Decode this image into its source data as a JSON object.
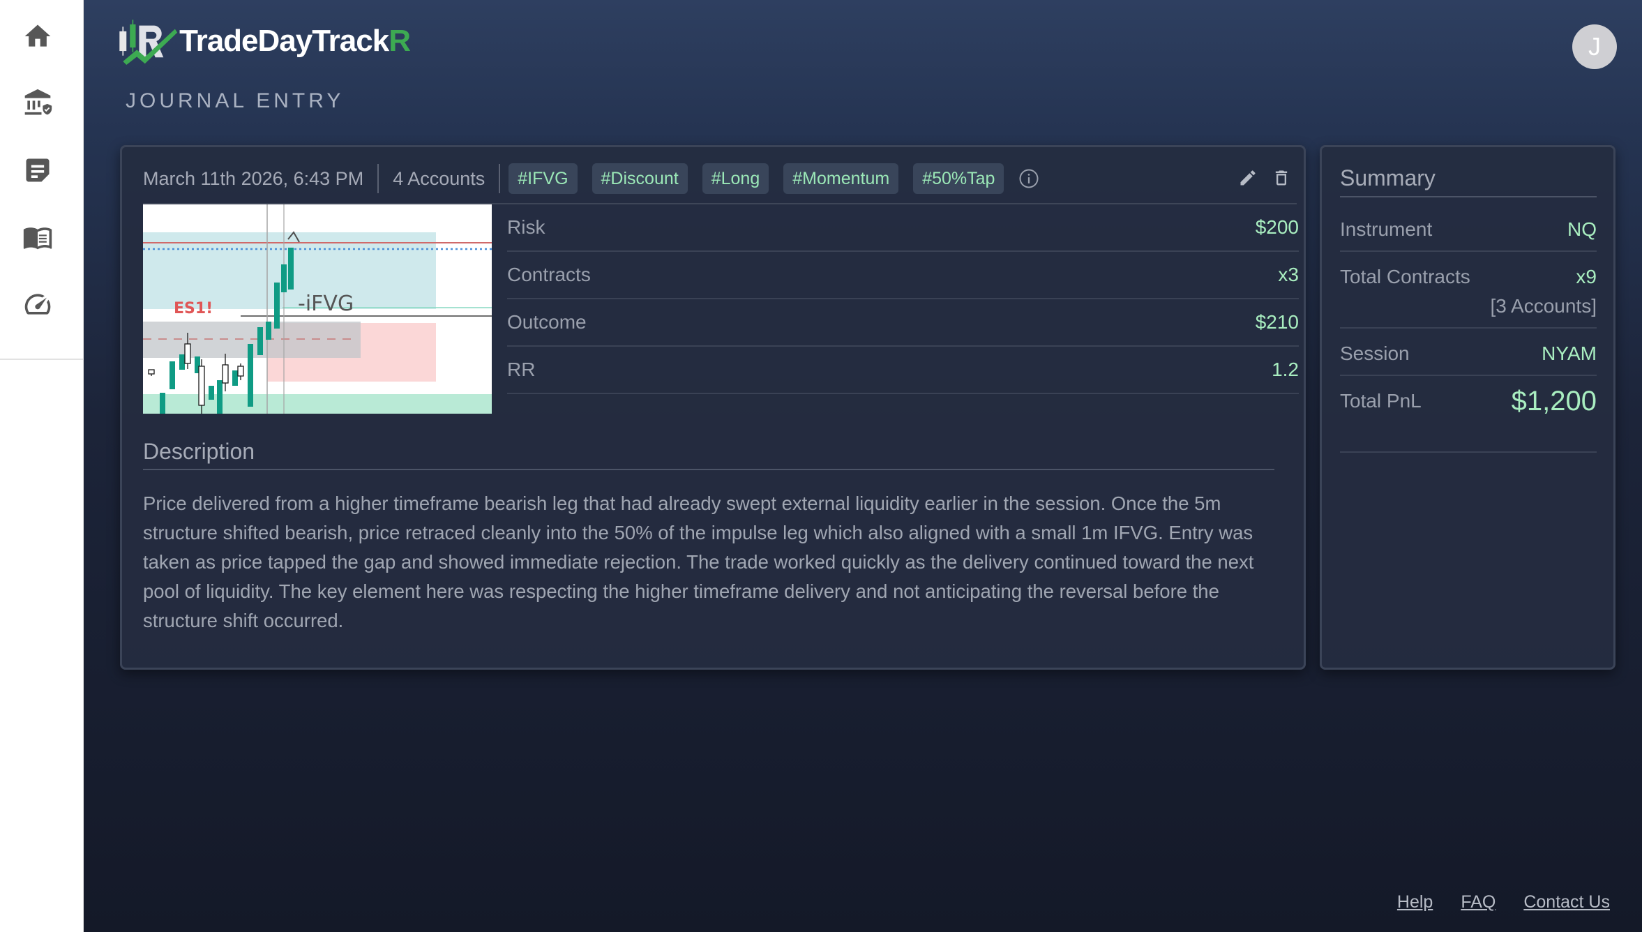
{
  "sidebar": {
    "items": [
      {
        "icon": "home-icon"
      },
      {
        "icon": "bank-shield-icon"
      },
      {
        "icon": "notes-icon"
      },
      {
        "icon": "book-icon"
      },
      {
        "icon": "speedometer-icon"
      }
    ]
  },
  "header": {
    "logo_text": "TradeDayTrack",
    "logo_text_accent": "R",
    "page_title": "JOURNAL ENTRY",
    "avatar_initial": "J"
  },
  "entry": {
    "date": "March 11th 2026, 6:43 PM",
    "accounts": "4 Accounts",
    "tags": [
      "#IFVG",
      "#Discount",
      "#Long",
      "#Momentum",
      "#50%Tap"
    ],
    "chart_labels": {
      "symbol": "ES1!",
      "marker": "-iFVG"
    },
    "metrics": [
      {
        "label": "Risk",
        "value": "$200"
      },
      {
        "label": "Contracts",
        "value": "x3"
      },
      {
        "label": "Outcome",
        "value": "$210"
      },
      {
        "label": "RR",
        "value": "1.2"
      }
    ],
    "description_title": "Description",
    "description": "Price delivered from a higher timeframe bearish leg that had already swept external liquidity earlier in the session. Once the 5m structure shifted bearish, price retraced cleanly into the 50% of the impulse leg which also aligned with a small 1m IFVG. Entry was taken as price tapped the gap and showed immediate rejection. The trade worked quickly as the delivery continued toward the next pool of liquidity. The key element here was respecting the higher timeframe delivery and not anticipating the reversal before the structure shift occurred."
  },
  "summary": {
    "title": "Summary",
    "instrument_label": "Instrument",
    "instrument_value": "NQ",
    "contracts_label": "Total Contracts",
    "contracts_value": "x9",
    "contracts_sub": "[3 Accounts]",
    "session_label": "Session",
    "session_value": "NYAM",
    "pnl_label": "Total PnL",
    "pnl_value": "$1,200"
  },
  "footer": {
    "help": "Help",
    "faq": "FAQ",
    "contact": "Contact Us"
  },
  "colors": {
    "accent_green": "#a9eec0",
    "tag_text": "#9be8b7",
    "logo_green": "#3daa52",
    "bg_dark": "#141928"
  }
}
